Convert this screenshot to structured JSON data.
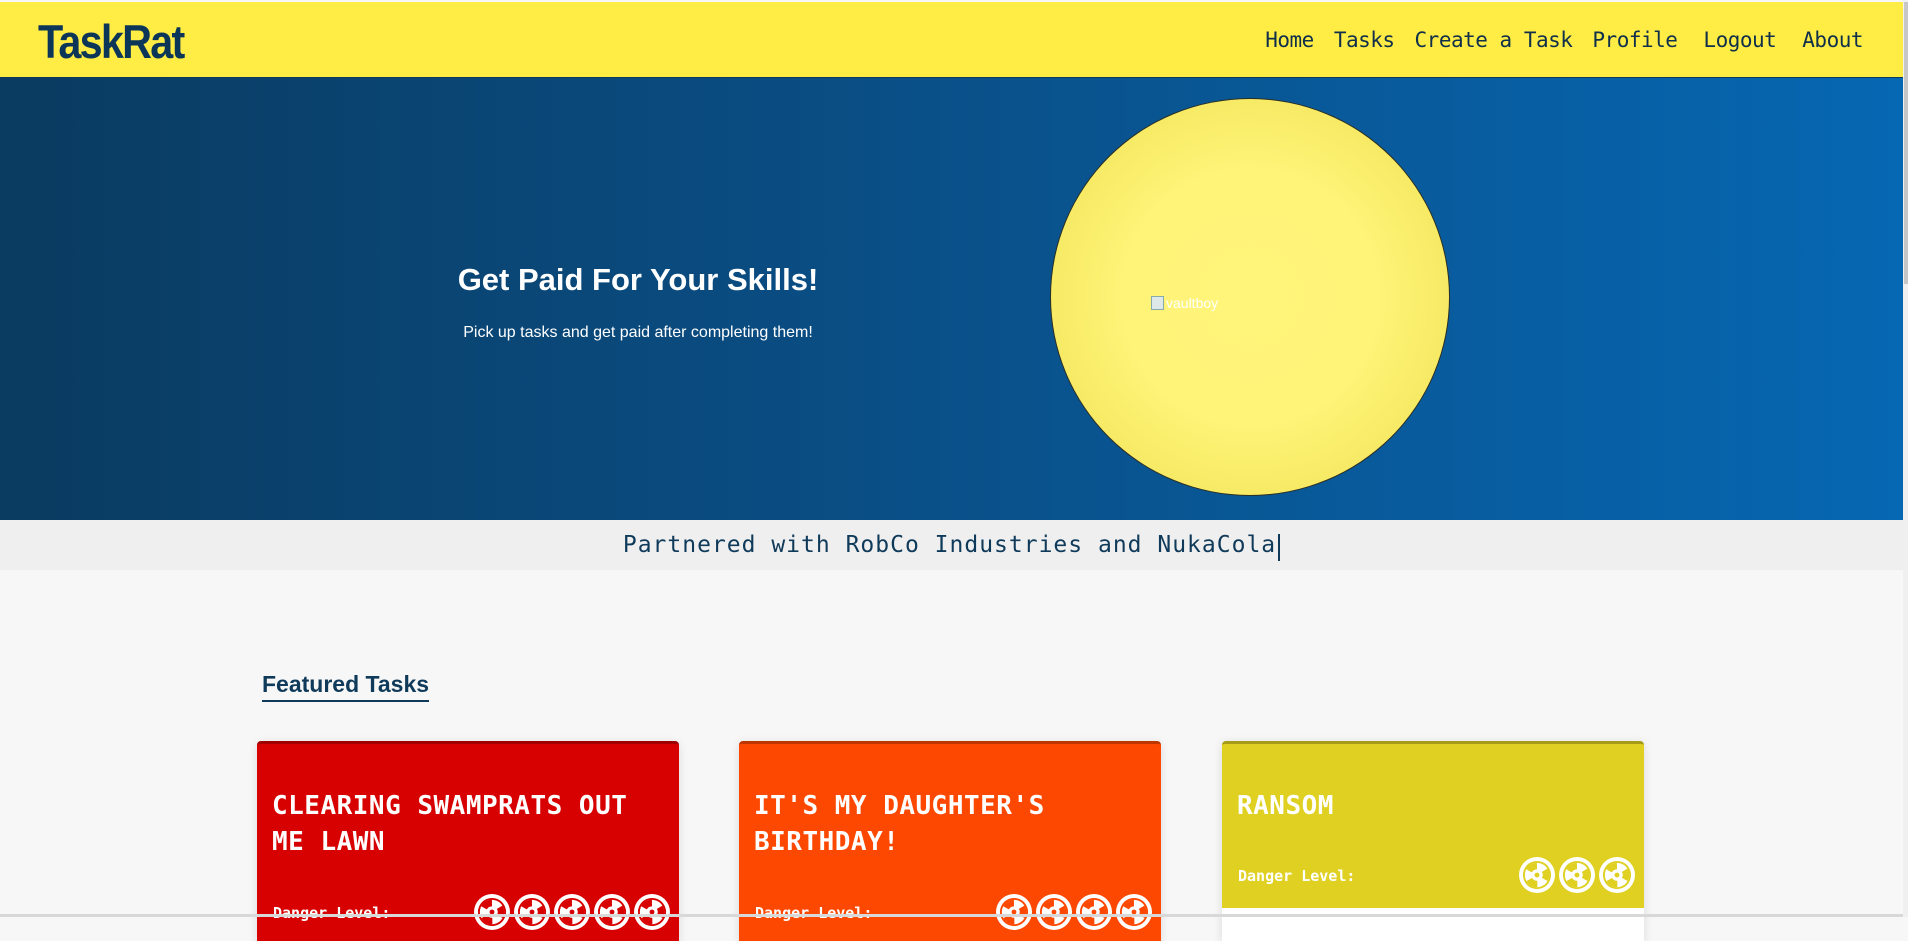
{
  "app": {
    "logo": "TaskRat"
  },
  "nav": {
    "items": [
      {
        "label": "Home"
      },
      {
        "label": "Tasks"
      },
      {
        "label": "Create a Task"
      },
      {
        "label": "Profile"
      },
      {
        "label": "Logout"
      },
      {
        "label": "About"
      }
    ]
  },
  "hero": {
    "title": "Get Paid For Your Skills!",
    "subtitle": "Pick up tasks and get paid after completing them!",
    "image_alt": "vaultboy"
  },
  "partner": {
    "text": "Partnered with RobCo Industries and NukaCola"
  },
  "featured": {
    "heading": "Featured Tasks",
    "cards": [
      {
        "title": "CLEARING SWAMPRATS OUT ME LAWN",
        "danger_label": "Danger Level:",
        "danger_level": 5,
        "color": "#d70101"
      },
      {
        "title": "IT'S MY DAUGHTER'S BIRTHDAY!",
        "danger_label": "Danger Level:",
        "danger_level": 4,
        "color": "#fd4801"
      },
      {
        "title": "RANSOM",
        "danger_label": "Danger Level:",
        "danger_level": 3,
        "color": "#dfd022"
      }
    ]
  },
  "colors": {
    "nav_bg": "#ffec45",
    "brand_navy": "#0b3658",
    "hero_from": "#0a3b60",
    "hero_to": "#0667b2"
  }
}
